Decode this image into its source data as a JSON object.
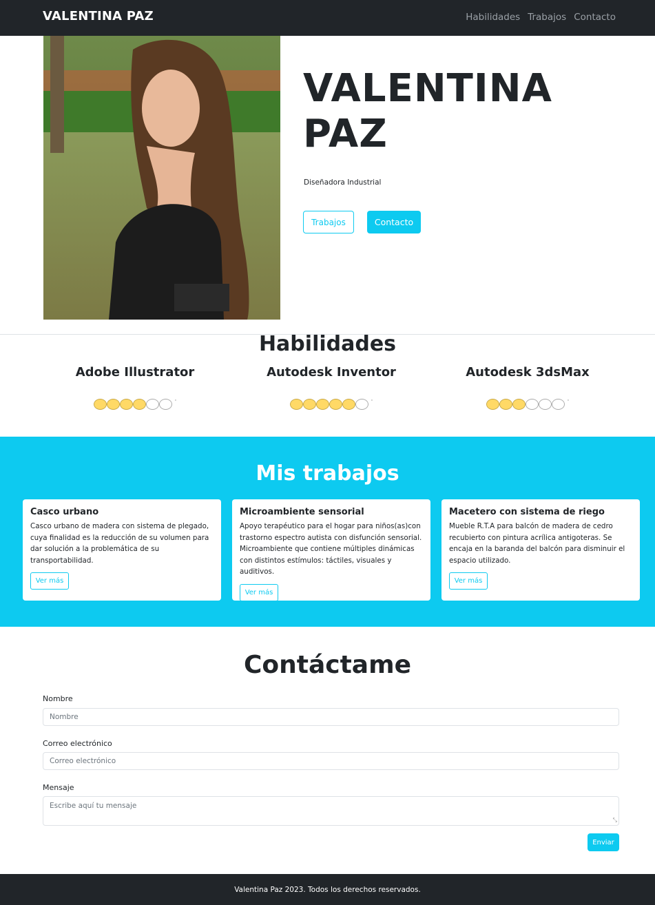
{
  "nav": {
    "brand": "VALENTINA PAZ",
    "links": [
      "Habilidades",
      "Trabajos",
      "Contacto"
    ]
  },
  "hero": {
    "name_line1": "VALENTINA",
    "name_line2": "PAZ",
    "subtitle": "Diseñadora Industrial",
    "btn_works": "Trabajos",
    "btn_contact": "Contacto"
  },
  "skills": {
    "title": "Habilidades",
    "items": [
      {
        "name": "Adobe Illustrator",
        "rating": 4,
        "max": 6
      },
      {
        "name": "Autodesk Inventor",
        "rating": 5,
        "max": 6
      },
      {
        "name": "Autodesk 3dsMax",
        "rating": 3,
        "max": 6
      }
    ]
  },
  "works": {
    "title": "Mis trabajos",
    "cards": [
      {
        "title": "Casco urbano",
        "text": "Casco urbano de madera con sistema de plegado, cuya finalidad es la reducción de su volumen para dar solución a la problemática de su transportabilidad.",
        "button": "Ver más"
      },
      {
        "title": "Microambiente sensorial",
        "text": "Apoyo terapéutico para el hogar para niños(as)con trastorno espectro autista con disfunción sensorial. Microambiente que contiene múltiples dinámicas con distintos estímulos: táctiles, visuales y auditivos.",
        "button": "Ver más"
      },
      {
        "title": "Macetero con sistema de riego",
        "text": "Mueble R.T.A para balcón de madera de cedro recubierto con pintura acrílica antigoteras. Se encaja en la baranda del balcón para disminuir el espacio utilizado.",
        "button": "Ver más"
      }
    ]
  },
  "contact": {
    "title": "Contáctame",
    "name_label": "Nombre",
    "name_placeholder": "Nombre",
    "email_label": "Correo electrónico",
    "email_placeholder": "Correo electrónico",
    "message_label": "Mensaje",
    "message_placeholder": "Escribe aquí tu mensaje",
    "submit": "Enviar"
  },
  "footer": {
    "text": "Valentina Paz 2023. Todos los derechos reservados."
  },
  "colors": {
    "accent": "#0dcaf0",
    "dark": "#212529",
    "star": "#ffd966"
  }
}
